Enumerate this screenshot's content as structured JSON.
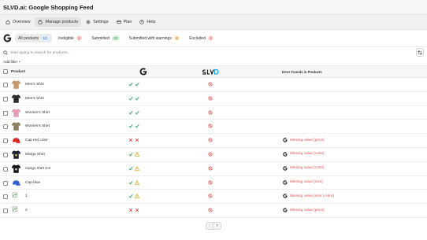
{
  "app": {
    "title": "SLVD.ai: Google Shopping Feed"
  },
  "nav": [
    {
      "label": "Overview",
      "icon": "home-icon",
      "active": false
    },
    {
      "label": "Manage products",
      "icon": "bag-icon",
      "active": true
    },
    {
      "label": "Settings",
      "icon": "gear-icon",
      "active": false
    },
    {
      "label": "Plan",
      "icon": "card-icon",
      "active": false
    },
    {
      "label": "Help",
      "icon": "help-icon",
      "active": false
    }
  ],
  "filter_tabs": [
    {
      "label": "All products",
      "count": "12",
      "bg": "#dbe9fb",
      "fg": "#2a5fa8",
      "active": true
    },
    {
      "label": "Ineligible",
      "count": "2",
      "bg": "#fbd9d9",
      "fg": "#b42b2b",
      "active": false
    },
    {
      "label": "Submitted",
      "count": "10",
      "bg": "#d3f3dc",
      "fg": "#1d7a3b",
      "active": false
    },
    {
      "label": "Submitted with warnings",
      "count": "6",
      "bg": "#fbe7c4",
      "fg": "#8f5b00",
      "active": false
    },
    {
      "label": "Excluded",
      "count": "2",
      "bg": "#fbd9d9",
      "fg": "#b42b2b",
      "active": false
    }
  ],
  "search": {
    "placeholder": "Start typing to search for products..."
  },
  "add_filter": "Add filter +",
  "table": {
    "headers": {
      "product": "Product",
      "errors": "Error Founds in Products"
    },
    "rows": [
      {
        "name": "Men's Shirt",
        "thumb": "shirt-tan",
        "google": [
          "ok",
          "ok"
        ],
        "error": ""
      },
      {
        "name": "Men's Shirt",
        "thumb": "shirt-black",
        "google": [
          "ok",
          "ok"
        ],
        "error": ""
      },
      {
        "name": "Women's Shirt",
        "thumb": "shirt-pink",
        "google": [
          "ok",
          "ok"
        ],
        "error": ""
      },
      {
        "name": "Women's Shirt",
        "thumb": "shirt-olive",
        "google": [
          "ok",
          "ok"
        ],
        "error": ""
      },
      {
        "name": "Cap red color",
        "thumb": "cap-red",
        "google": [
          "bad",
          "bad"
        ],
        "error": "Missing value [price]"
      },
      {
        "name": "Margo Shirt",
        "thumb": "shirt-navy",
        "google": [
          "ok",
          "warn"
        ],
        "error": "Missing value [color]"
      },
      {
        "name": "margo shirt 2.0",
        "thumb": "shirt-dark",
        "google": [
          "ok",
          "warn"
        ],
        "error": "Missing value [color]"
      },
      {
        "name": "Cap blue",
        "thumb": "cap-blue",
        "google": [
          "ok",
          "warn"
        ],
        "error": "Missing value [size]"
      },
      {
        "name": "1",
        "thumb": "broken",
        "google": [
          "ok",
          "warn"
        ],
        "error": "Missing value [size | color]"
      },
      {
        "name": "2",
        "thumb": "broken",
        "google": [
          "bad",
          "bad"
        ],
        "error": "Missing value [price]"
      }
    ]
  },
  "colors": {
    "ok": "#29a35a",
    "bad": "#e04848",
    "warn": "#d6a300",
    "blocked": "#e04848",
    "error_text": "#e05252"
  }
}
